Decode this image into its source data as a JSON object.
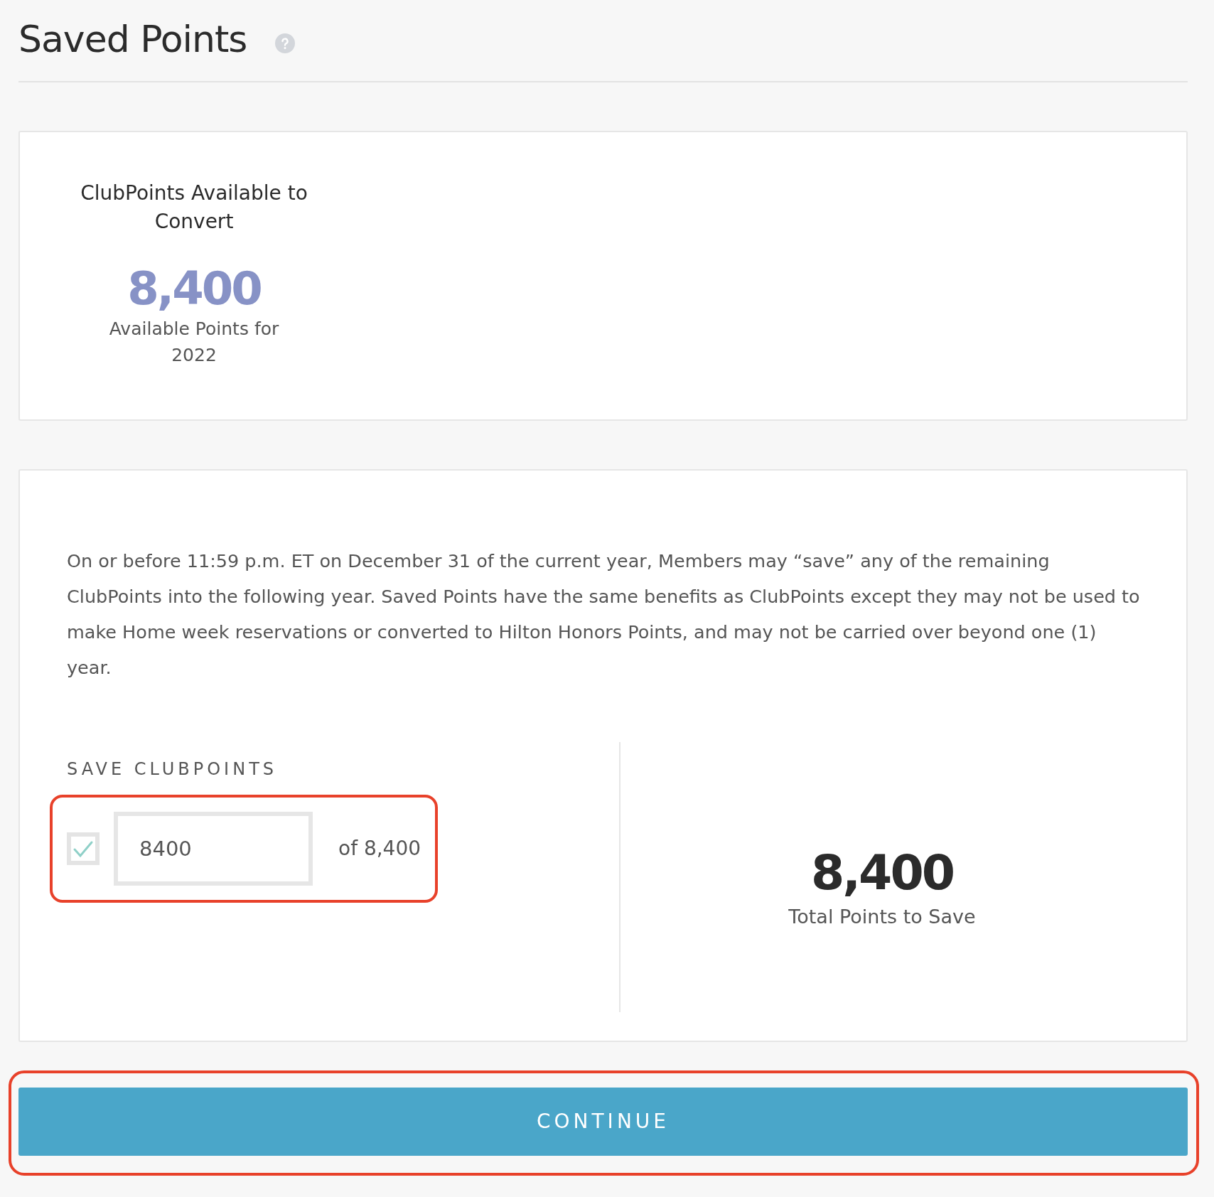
{
  "page": {
    "title": "Saved Points",
    "help_icon": true
  },
  "available": {
    "heading": "ClubPoints Available to Convert",
    "points": "8,400",
    "caption": "Available Points for 2022"
  },
  "info": {
    "text": "On or before 11:59 p.m. ET on December 31 of the current year, Members may “save” any of the remaining ClubPoints into the following year. Saved Points have the same benefits as ClubPoints except they may not be used to make Home week reservations or converted to Hilton Honors Points, and may not be carried over beyond one (1) year."
  },
  "save": {
    "label": "SAVE CLUBPOINTS",
    "checked": true,
    "value": "8400",
    "of_text": "of 8,400",
    "highlighted": true
  },
  "total": {
    "points": "8,400",
    "caption": "Total Points to Save"
  },
  "continue_button": {
    "label": "CONTINUE",
    "highlighted": true
  }
}
